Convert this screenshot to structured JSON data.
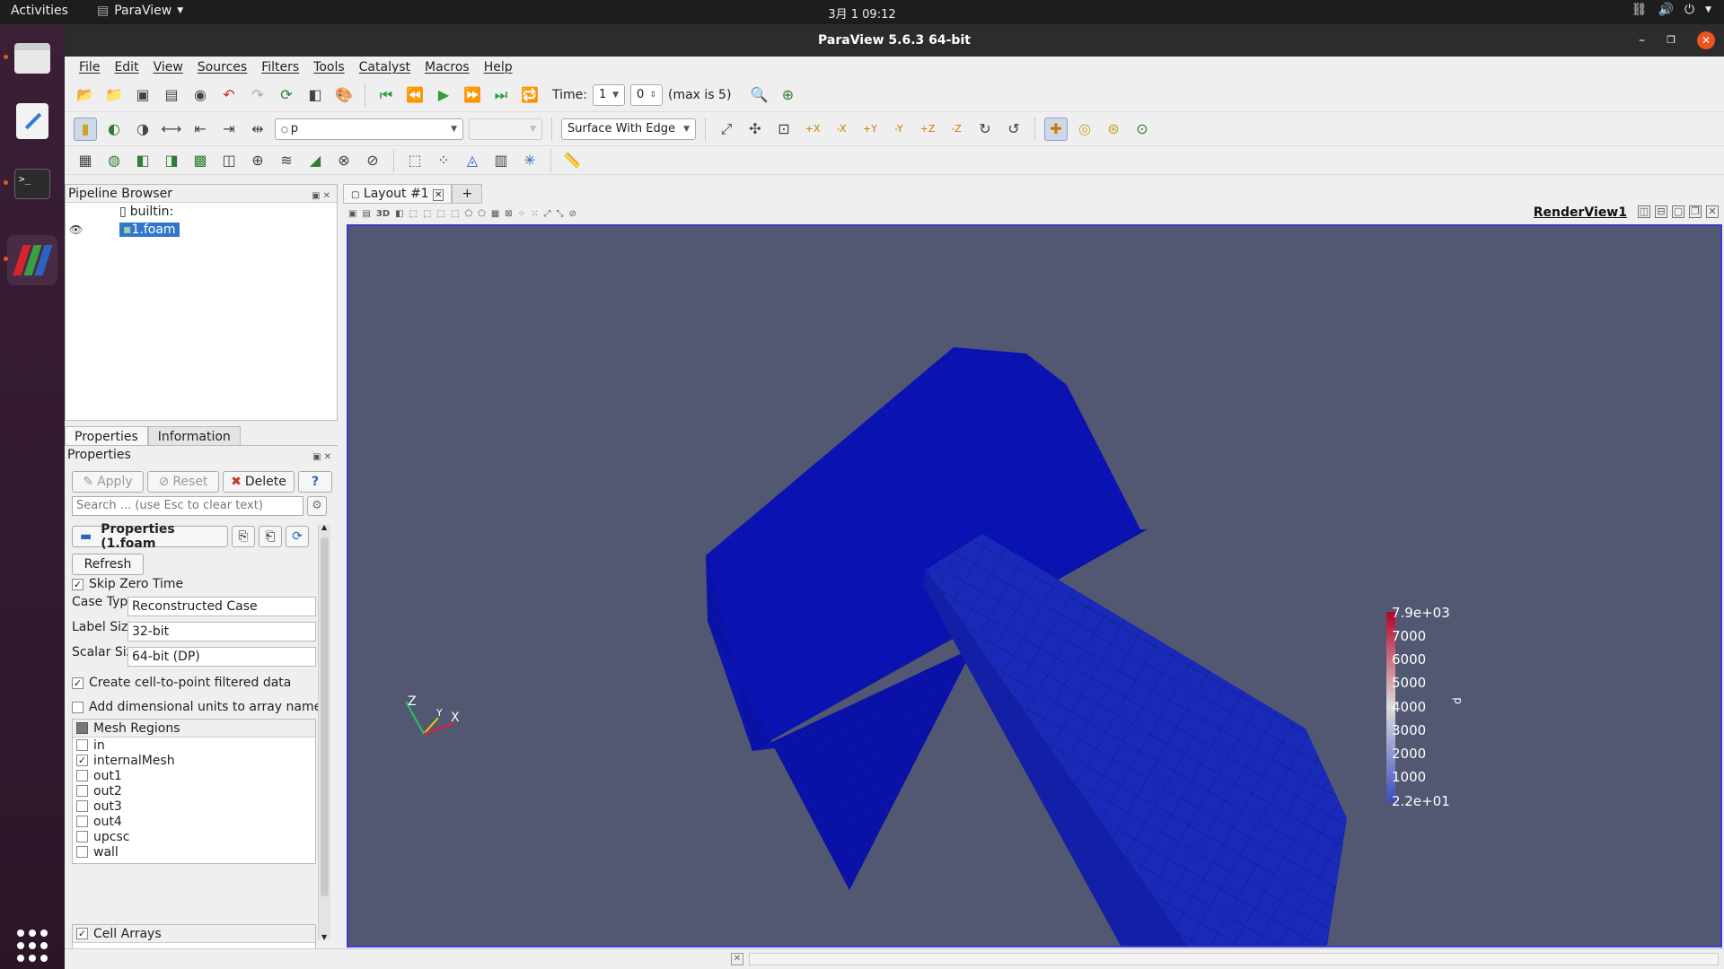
{
  "system": {
    "activities": "Activities",
    "app_menu": "ParaView",
    "clock": "3月 1  09:12"
  },
  "window": {
    "title": "ParaView 5.6.3 64-bit"
  },
  "menu": [
    "File",
    "Edit",
    "View",
    "Sources",
    "Filters",
    "Tools",
    "Catalyst",
    "Macros",
    "Help"
  ],
  "time_toolbar": {
    "label": "Time:",
    "time_value": "1",
    "index_value": "0",
    "max_text": "(max is 5)"
  },
  "display_toolbar": {
    "color_by": "p",
    "component": "",
    "representation": "Surface With Edge"
  },
  "pipeline": {
    "title": "Pipeline Browser",
    "items": [
      {
        "name": "builtin:"
      },
      {
        "name": "1.foam"
      }
    ]
  },
  "tabs": {
    "properties": "Properties",
    "information": "Information"
  },
  "properties": {
    "title": "Properties",
    "apply": "Apply",
    "reset": "Reset",
    "delete": "Delete",
    "help": "?",
    "search_placeholder": "Search ... (use Esc to clear text)",
    "section_title": "Properties (1.foam",
    "refresh": "Refresh",
    "skip_zero_time": "Skip Zero Time",
    "case_type_label": "Case Type",
    "case_type_value": "Reconstructed Case",
    "label_size_label": "Label Size",
    "label_size_value": "32-bit",
    "scalar_size_label": "Scalar Size",
    "scalar_size_value": "64-bit (DP)",
    "cell_to_point": "Create cell-to-point filtered data",
    "dimensional_units": "Add dimensional units to array names",
    "mesh_regions_title": "Mesh Regions",
    "mesh_regions": [
      {
        "name": "in",
        "checked": false
      },
      {
        "name": "internalMesh",
        "checked": true
      },
      {
        "name": "out1",
        "checked": false
      },
      {
        "name": "out2",
        "checked": false
      },
      {
        "name": "out3",
        "checked": false
      },
      {
        "name": "out4",
        "checked": false
      },
      {
        "name": "upcsc",
        "checked": false
      },
      {
        "name": "wall",
        "checked": false
      }
    ],
    "cell_arrays_title": "Cell Arrays"
  },
  "layout": {
    "tab_name": "Layout #1",
    "add_tab": "+",
    "view_name": "RenderView1",
    "viewbar_3d": "3D"
  },
  "colorbar": {
    "labels": [
      "7.9e+03",
      "7000",
      "6000",
      "5000",
      "4000",
      "3000",
      "2000",
      "1000",
      "2.2e+01"
    ],
    "title": "p",
    "color_top": "#b40426",
    "color_mid": "#dddddd",
    "color_bottom": "#3b4cc0"
  },
  "axes": {
    "z": "Z",
    "y": "Y",
    "x": "X"
  },
  "colors": {
    "background": "#525871",
    "mesh": "#0c1aa6",
    "selection": "#3277c9"
  }
}
